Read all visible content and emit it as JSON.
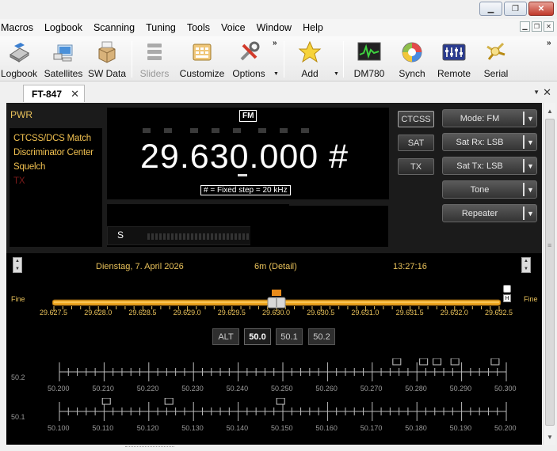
{
  "window": {
    "minimize_glyph": "▁",
    "maximize_glyph": "❐",
    "close_glyph": "✕"
  },
  "menubar": {
    "items": [
      "Macros",
      "Logbook",
      "Scanning",
      "Tuning",
      "Tools",
      "Voice",
      "Window",
      "Help"
    ]
  },
  "toolbar": {
    "items": [
      {
        "label": "Logbook",
        "icon": "logbook-icon"
      },
      {
        "label": "Satellites",
        "icon": "satellites-icon"
      },
      {
        "label": "SW Data",
        "icon": "sw-data-icon"
      },
      {
        "label": "Sliders",
        "icon": "sliders-icon"
      },
      {
        "label": "Customize",
        "icon": "customize-icon"
      },
      {
        "label": "Options",
        "icon": "options-icon"
      },
      {
        "label": "Add",
        "icon": "star-icon"
      },
      {
        "label": "DM780",
        "icon": "dm780-icon"
      },
      {
        "label": "Synch",
        "icon": "synch-icon"
      },
      {
        "label": "Remote",
        "icon": "remote-icon"
      },
      {
        "label": "Serial",
        "icon": "serial-icon"
      }
    ],
    "more_glyph": "»"
  },
  "tab": {
    "title": "FT-847",
    "close_glyph": "✕"
  },
  "radio": {
    "pwr_label": "PWR",
    "status_items": [
      {
        "text": "CTCSS/DCS Match",
        "active": true
      },
      {
        "text": "Discriminator Center",
        "active": true
      },
      {
        "text": "Squelch",
        "active": true
      },
      {
        "text": "TX",
        "active": false
      }
    ],
    "mode_badge": "FM",
    "frequency": "29.630.000 #",
    "step_note": "# = Fixed step = 20 kHz",
    "smeter_label": "S",
    "buttons": {
      "ctcss": "CTCSS",
      "sat": "SAT",
      "tx": "TX"
    },
    "dropdowns": {
      "mode": "Mode: FM",
      "sat_rx": "Sat Rx: LSB",
      "sat_tx": "Sat Tx: LSB",
      "tone": "Tone",
      "repeater": "Repeater"
    }
  },
  "tuning": {
    "date": "Dienstag, 7. April 2026",
    "band": "6m (Detail)",
    "time": "13:27:16",
    "fine_left": "Fine",
    "fine_right": "Fine",
    "slider_ticks": [
      "29.627.5",
      "29.628.0",
      "29.628.5",
      "29.629.0",
      "29.629.5",
      "29.630.0",
      "29.630.5",
      "29.631.0",
      "29.631.5",
      "29.632.0",
      "29.632.5"
    ],
    "slider_value": "29.630.0",
    "h_label": "H",
    "band_buttons": [
      "ALT",
      "50.0",
      "50.1",
      "50.2"
    ],
    "scale1": {
      "side_label": "50.2",
      "labels": [
        "50.200",
        "50.210",
        "50.220",
        "50.230",
        "50.240",
        "50.250",
        "50.260",
        "50.270",
        "50.280",
        "50.290",
        "50.300"
      ],
      "markers": [
        50.2755,
        50.2815,
        50.2845,
        50.2885,
        50.2975
      ]
    },
    "scale2": {
      "side_label": "50.1",
      "labels": [
        "50.100",
        "50.110",
        "50.120",
        "50.130",
        "50.140",
        "50.150",
        "50.160",
        "50.170",
        "50.180",
        "50.190",
        "50.200"
      ],
      "markers": [
        50.1105,
        50.1245,
        50.1495
      ]
    }
  }
}
